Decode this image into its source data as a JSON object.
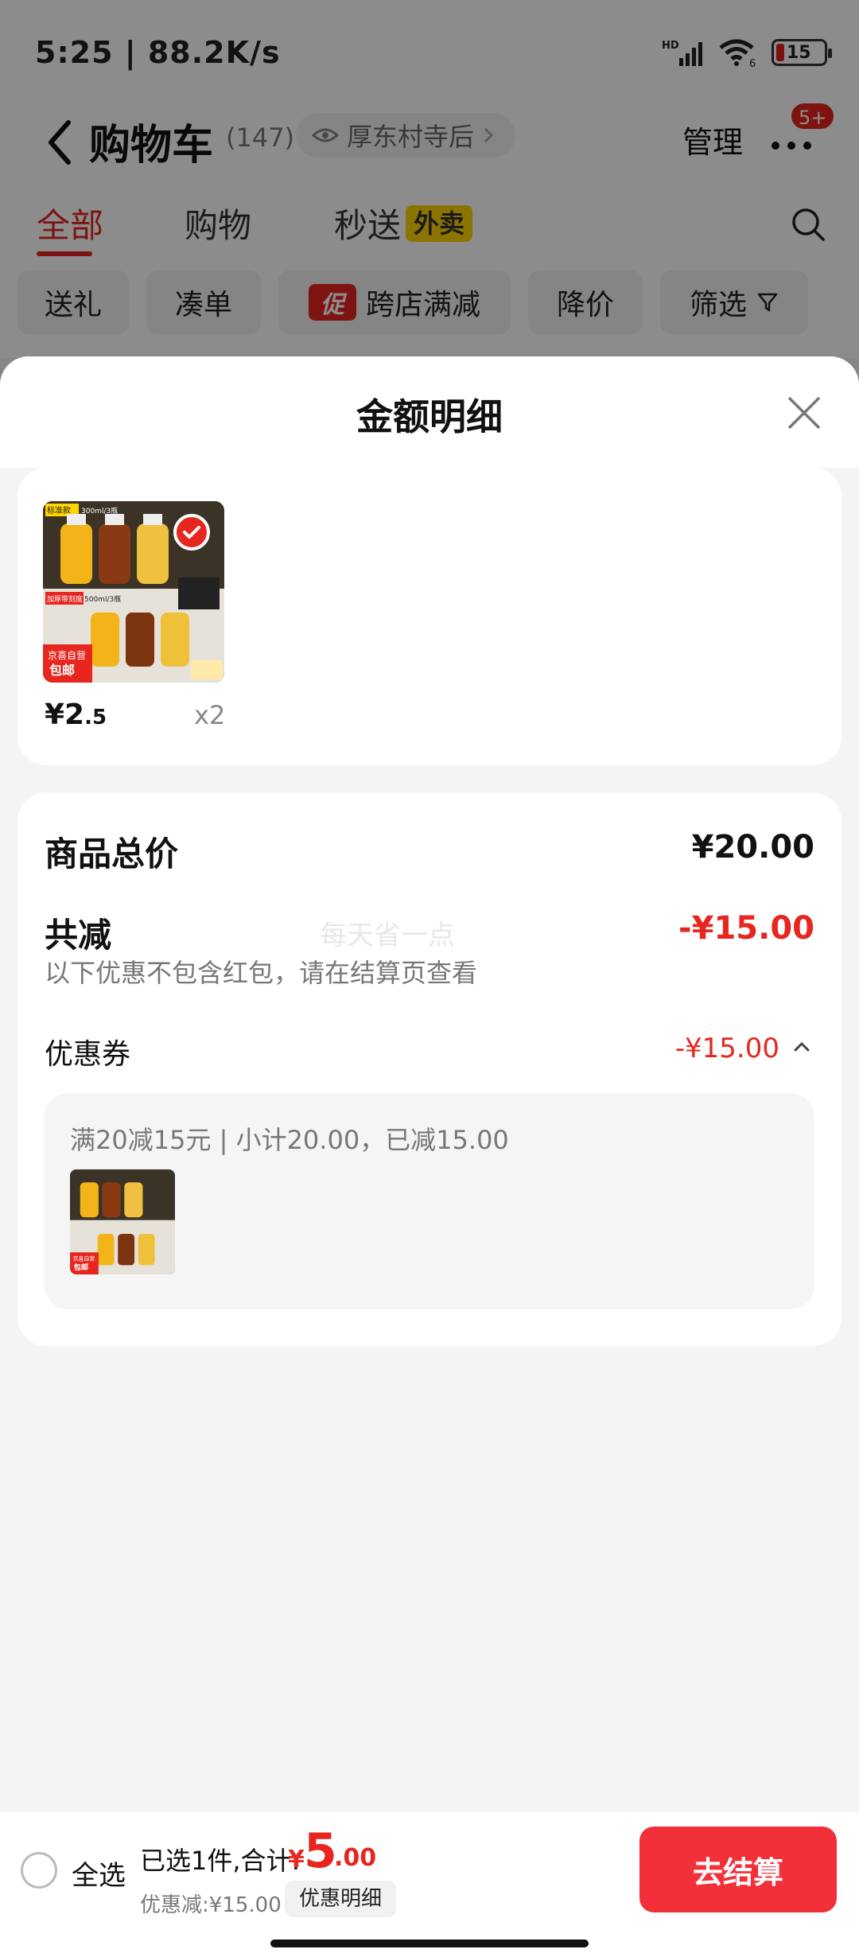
{
  "status_bar": {
    "time_speed": "5:25 | 88.2K/s",
    "signal_label": "HD",
    "wifi_label": "6",
    "battery": "15"
  },
  "header": {
    "title": "购物车",
    "count": "(147)",
    "location": "厚东村寺后",
    "manage": "管理",
    "badge": "5+"
  },
  "tabs": [
    {
      "label": "全部"
    },
    {
      "label": "购物"
    },
    {
      "label": "秒送"
    }
  ],
  "tab_badge": "外卖",
  "chips": [
    {
      "label": "送礼"
    },
    {
      "label": "凑单"
    },
    {
      "label": "跨店满减",
      "tag": "促"
    },
    {
      "label": "降价"
    },
    {
      "label": "筛选"
    }
  ],
  "sheet": {
    "title": "金额明细",
    "product": {
      "price_int": "¥2",
      "price_dec": ".5",
      "qty": "x2",
      "img_text_top": "标准款",
      "img_text_top2": "300ml/3瓶",
      "img_text_mid": "加厚带刻度",
      "img_text_mid2": "500ml/3瓶",
      "img_brand1": "京喜自营",
      "img_brand2": "包邮"
    },
    "summary": {
      "total_label": "商品总价",
      "total_value": "¥20.00",
      "reduce_label": "共减",
      "reduce_value": "-¥15.00",
      "note": "以下优惠不包含红包，请在结算页查看",
      "watermark": "每天省一点",
      "coupon_label": "优惠券",
      "coupon_value": "-¥15.00",
      "coupon_rule": "满20减15元 | 小计20.00，已减15.00"
    }
  },
  "bottom": {
    "select_all": "全选",
    "selected": "已选1件,合计:",
    "yen": "¥",
    "total_int": "5",
    "total_dec": ".00",
    "discount": "优惠减:¥15.00",
    "detail": "优惠明细",
    "checkout": "去结算"
  },
  "colors": {
    "accent": "#e6261f",
    "checkout": "#f2303a",
    "badge_yellow": "#ffd400"
  }
}
